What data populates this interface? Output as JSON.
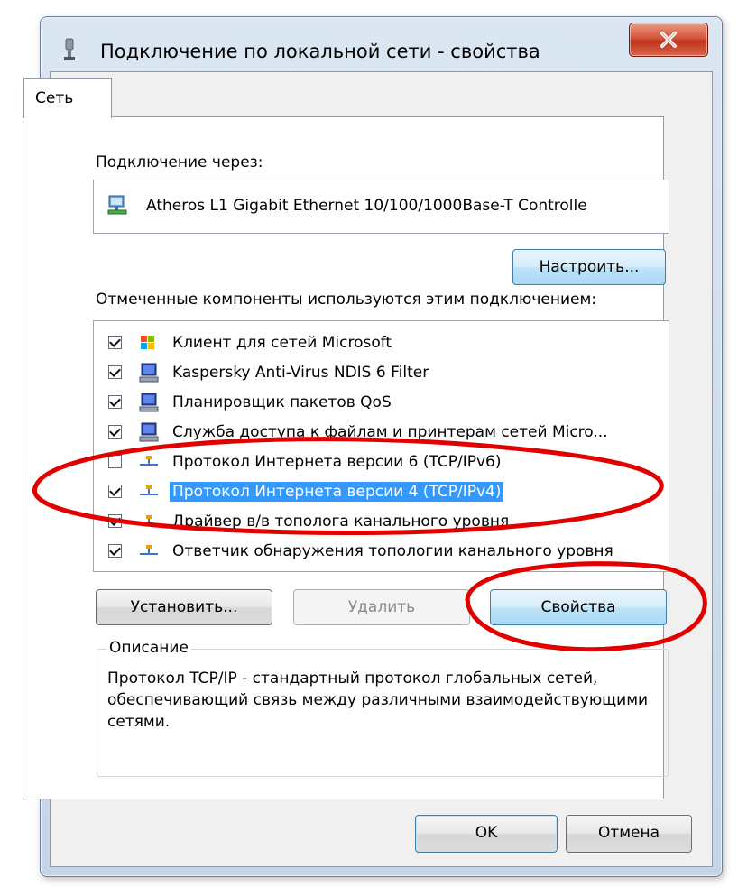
{
  "window": {
    "title": "Подключение по локальной сети - свойства",
    "close_label": "x"
  },
  "tabs": [
    {
      "label": "Сеть",
      "active": true
    }
  ],
  "connect_via": {
    "label": "Подключение через:",
    "adapter_name": "Atheros L1 Gigabit Ethernet 10/100/1000Base-T Controlle",
    "configure_label": "Настроить..."
  },
  "components": {
    "label": "Отмеченные компоненты используются этим подключением:",
    "items": [
      {
        "label": "Клиент для сетей Microsoft",
        "checked": true,
        "icon": "client-icon",
        "selected": false
      },
      {
        "label": "Kaspersky Anti-Virus NDIS 6 Filter",
        "checked": true,
        "icon": "computer-icon",
        "selected": false
      },
      {
        "label": "Планировщик пакетов QoS",
        "checked": true,
        "icon": "computer-icon",
        "selected": false
      },
      {
        "label": "Служба доступа к файлам и принтерам сетей Micro...",
        "checked": true,
        "icon": "computer-icon",
        "selected": false
      },
      {
        "label": "Протокол Интернета версии 6 (TCP/IPv6)",
        "checked": false,
        "icon": "protocol-icon",
        "selected": false
      },
      {
        "label": "Протокол Интернета версии 4 (TCP/IPv4)",
        "checked": true,
        "icon": "protocol-icon",
        "selected": true
      },
      {
        "label": "Драйвер в/в тополога канального уровня",
        "checked": true,
        "icon": "protocol-icon",
        "selected": false
      },
      {
        "label": "Ответчик обнаружения топологии канального уровня",
        "checked": true,
        "icon": "protocol-icon",
        "selected": false
      }
    ]
  },
  "actions": {
    "install_label": "Установить...",
    "uninstall_label": "Удалить",
    "properties_label": "Свойства"
  },
  "description": {
    "legend": "Описание",
    "text": "Протокол TCP/IP - стандартный протокол глобальных сетей, обеспечивающий связь между различными взаимодействующими сетями."
  },
  "footer": {
    "ok_label": "OK",
    "cancel_label": "Отмена"
  },
  "colors": {
    "selection": "#3399ff",
    "annotation": "#e00000",
    "close_button": "#c0321b"
  }
}
